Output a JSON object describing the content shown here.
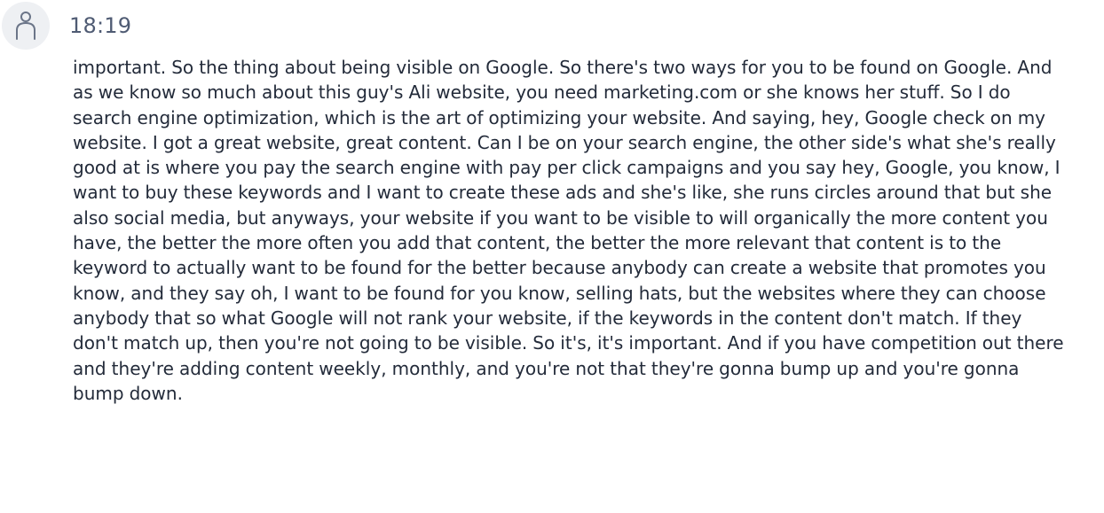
{
  "segment": {
    "speaker_icon": "user-icon",
    "timestamp": "18:19",
    "text": "important. So the thing about being visible on Google. So there's two ways for you to be found on Google. And as we know so much about this guy's Ali website, you need marketing.com or she knows her stuff. So I do search engine optimization, which is the art of optimizing your website. And saying, hey, Google check on my website. I got a great website, great content. Can I be on your search engine, the other side's what she's really good at is where you pay the search engine with pay per click campaigns and you say hey, Google, you know, I want to buy these keywords and I want to create these ads and she's like, she runs circles around that but she also social media, but anyways, your website if you want to be visible to will organically the more content you have, the better the more often you add that content, the better the more relevant that content is to the keyword to actually want to be found for the better because anybody can create a website that promotes you know, and they say oh, I want to be found for you know, selling hats, but the websites where they can choose anybody that so what Google will not rank your website, if the keywords in the content don't match. If they don't match up, then you're not going to be visible. So it's, it's important. And if you have competition out there and they're adding content weekly, monthly, and you're not that they're gonna bump up and you're gonna bump down."
  }
}
